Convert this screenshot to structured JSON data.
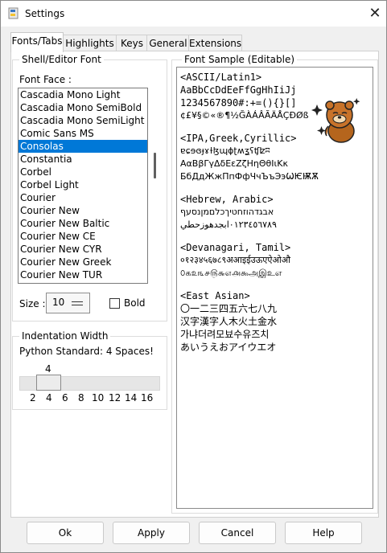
{
  "window": {
    "title": "Settings"
  },
  "tabs": [
    {
      "label": "Fonts/Tabs"
    },
    {
      "label": "Highlights"
    },
    {
      "label": "Keys"
    },
    {
      "label": "General"
    },
    {
      "label": "Extensions"
    }
  ],
  "font_group": {
    "title": "Shell/Editor Font",
    "face_label": "Font Face :",
    "fonts": [
      {
        "label": "Cascadia Mono Light"
      },
      {
        "label": "Cascadia Mono SemiBold"
      },
      {
        "label": "Cascadia Mono SemiLight"
      },
      {
        "label": "Comic Sans MS"
      },
      {
        "label": "Consolas"
      },
      {
        "label": "Constantia"
      },
      {
        "label": "Corbel"
      },
      {
        "label": "Corbel Light"
      },
      {
        "label": "Courier"
      },
      {
        "label": "Courier New"
      },
      {
        "label": "Courier New Baltic"
      },
      {
        "label": "Courier New CE"
      },
      {
        "label": "Courier New CYR"
      },
      {
        "label": "Courier New Greek"
      },
      {
        "label": "Courier New TUR"
      }
    ],
    "selected_font": "Consolas",
    "size_label": "Size :",
    "size_value": "10",
    "bold_label": "Bold",
    "bold_checked": false
  },
  "indent_group": {
    "title": "Indentation Width",
    "subtitle": "Python Standard: 4 Spaces!",
    "value": "4",
    "ticks": [
      "2",
      "4",
      "6",
      "8",
      "10",
      "12",
      "14",
      "16"
    ]
  },
  "sample_group": {
    "title": "Font Sample (Editable)",
    "lines": [
      "<ASCII/Latin1>",
      "AaBbCcDdEeFfGgHhIiJj",
      "1234567890#:+=(){}[]",
      "¢£¥§©«®¶½ĞÀÁÂÃÄÅÇÐØß",
      "",
      "<IPA,Greek,Cyrillic>",
      "ɐɕɘɞɟɤɫɮɰɸʈʍʓʕʧʫʭ",
      "ΑαΒβΓγΔδΕεΖζΗηΘθΙιΚκ",
      "БбДдЖжПпФфЧчЪъЭэѠѤѬѪ",
      "",
      "<Hebrew, Arabic>",
      "אבגדהוזחטיךכלםמןנסעף",
      "٠١٢٣٤٥٦٧٨٩ابجدهوزحطي",
      "",
      "<Devanagari, Tamil>",
      "०१२३४५६७८९अआइईउऊएऐओऔ",
      "௦௧௨௩௪௫௬௭௮௯அஇஉஎ",
      "",
      "<East Asian>",
      "〇一二三四五六七八九",
      "汉字漢字人木火土金水",
      "가냐더려모뵤수유즈치",
      "あいうえおアイウエオ"
    ]
  },
  "buttons": {
    "ok": "Ok",
    "apply": "Apply",
    "cancel": "Cancel",
    "help": "Help"
  },
  "colors": {
    "selection": "#0078d7",
    "window_bg": "#f0f0f0"
  },
  "icons": [
    "settings-app-icon",
    "close-icon",
    "dropdown-arrow-icon",
    "sticker-image"
  ]
}
